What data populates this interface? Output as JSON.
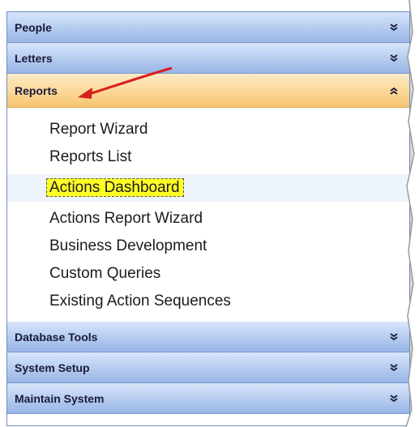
{
  "sections": [
    {
      "label": "People",
      "expanded": false
    },
    {
      "label": "Letters",
      "expanded": false
    },
    {
      "label": "Reports",
      "expanded": true
    },
    {
      "label": "Database Tools",
      "expanded": false
    },
    {
      "label": "System Setup",
      "expanded": false
    },
    {
      "label": "Maintain System",
      "expanded": false
    }
  ],
  "reports_items": [
    "Report Wizard",
    "Reports List",
    "Actions Dashboard",
    "Actions Report Wizard",
    "Business Development",
    "Custom Queries",
    "Existing Action Sequences"
  ],
  "selected_item": "Actions Dashboard",
  "colors": {
    "header_blue": "#b7cdf0",
    "header_active": "#fbd795",
    "highlight": "#ffff28",
    "arrow": "#d62020"
  },
  "icons": {
    "collapse": "chevron-double-down-icon",
    "expand": "chevron-double-up-icon",
    "annotation": "red-arrow-icon"
  }
}
